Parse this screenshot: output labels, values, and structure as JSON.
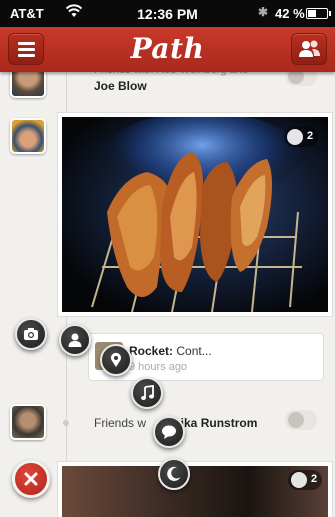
{
  "status_bar": {
    "carrier": "AT&T",
    "time": "12:36 PM",
    "battery": "42 %",
    "battery_level": 0.42
  },
  "navbar": {
    "title": "Path",
    "menu_icon": "hamburger-menu-icon",
    "friends_icon": "friends-icon",
    "color": "#b8301f"
  },
  "feed": {
    "row1": {
      "text": "Friends with Rob Weinberg and",
      "name": "Joe Blow",
      "emoji_count": ""
    },
    "photo_post": {
      "emoji_count": "2"
    },
    "rocket_post": {
      "name": "Rocket:",
      "text": "Cont...",
      "time": "9 hours ago"
    },
    "friends_post": {
      "prefix": "Friends w",
      "name": "onika Runstrom"
    },
    "bottom_post": {
      "emoji_count": "2"
    }
  },
  "radial_menu": [
    {
      "icon": "camera-icon"
    },
    {
      "icon": "person-icon"
    },
    {
      "icon": "place-icon"
    },
    {
      "icon": "music-icon"
    },
    {
      "icon": "thought-icon"
    },
    {
      "icon": "sleep-icon"
    }
  ],
  "close_button": {
    "icon": "close-icon",
    "color": "#d43a2e"
  }
}
